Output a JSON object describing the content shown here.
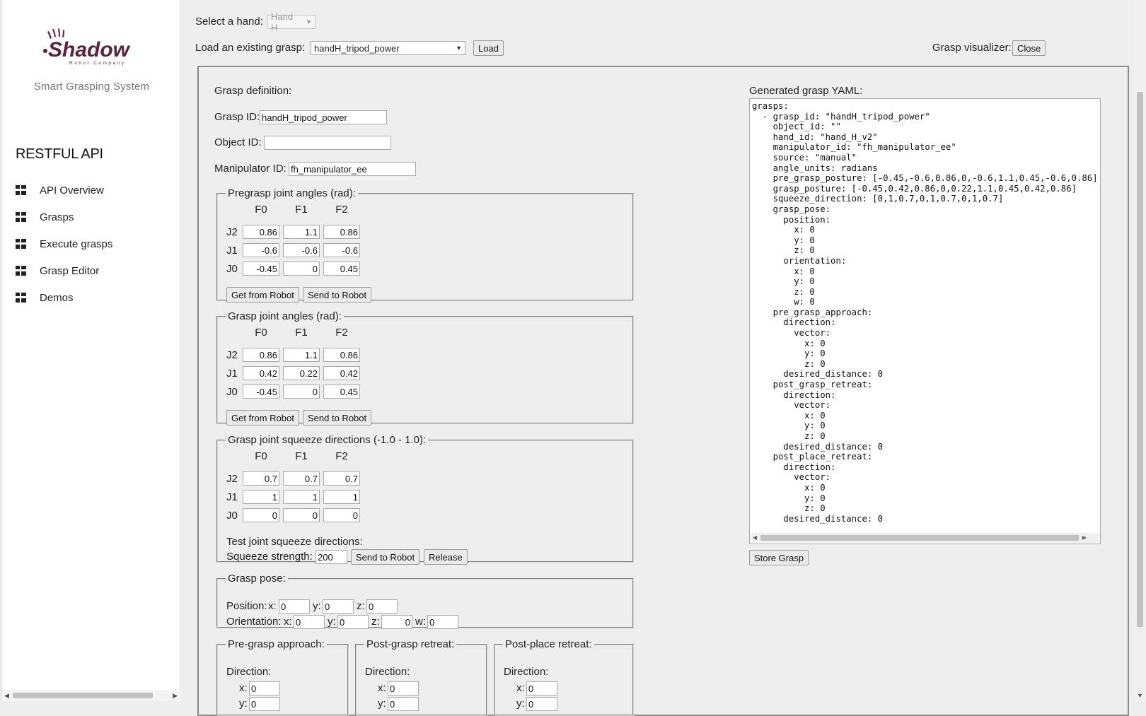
{
  "sidebar": {
    "logo_text": "Shadow",
    "logo_tagline": "Robot Company",
    "subtitle": "Smart Grasping System",
    "heading": "RESTFUL API",
    "nav": [
      {
        "label": "API Overview",
        "icon": "grid-icon"
      },
      {
        "label": "Grasps",
        "icon": "grid-icon"
      },
      {
        "label": "Execute grasps",
        "icon": "grid-icon"
      },
      {
        "label": "Grasp Editor",
        "icon": "grid-icon"
      },
      {
        "label": "Demos",
        "icon": "grid-icon"
      }
    ]
  },
  "top": {
    "select_hand_label": "Select a hand:",
    "hand_value": "Hand H",
    "load_label": "Load an existing grasp:",
    "grasp_value": "handH_tripod_power",
    "load_button": "Load",
    "visualizer_label": "Grasp visualizer:",
    "close_button": "Close"
  },
  "definition": {
    "title": "Grasp definition:",
    "grasp_id_label": "Grasp ID:",
    "grasp_id": "handH_tripod_power",
    "object_id_label": "Object ID:",
    "object_id": "",
    "manipulator_id_label": "Manipulator ID:",
    "manipulator_id": "fh_manipulator_ee"
  },
  "columns": [
    "F0",
    "F1",
    "F2"
  ],
  "rows": [
    "J2",
    "J1",
    "J0"
  ],
  "pregrasp": {
    "title": "Pregrasp joint angles (rad):",
    "values": [
      [
        "0.86",
        "1.1",
        "0.86"
      ],
      [
        "-0.6",
        "-0.6",
        "-0.6"
      ],
      [
        "-0.45",
        "0",
        "0.45"
      ]
    ],
    "get_button": "Get from Robot",
    "send_button": "Send to Robot"
  },
  "grasp": {
    "title": "Grasp joint angles (rad):",
    "values": [
      [
        "0.86",
        "1.1",
        "0.86"
      ],
      [
        "0.42",
        "0.22",
        "0.42"
      ],
      [
        "-0.45",
        "0",
        "0.45"
      ]
    ],
    "get_button": "Get from Robot",
    "send_button": "Send to Robot"
  },
  "squeeze": {
    "title": "Grasp joint squeeze directions (-1.0 - 1.0):",
    "values": [
      [
        "0.7",
        "0.7",
        "0.7"
      ],
      [
        "1",
        "1",
        "1"
      ],
      [
        "0",
        "0",
        "0"
      ]
    ],
    "test_label": "Test joint squeeze directions:",
    "strength_label": "Squeeze strength:",
    "strength": "200",
    "send_button": "Send to Robot",
    "release_button": "Release"
  },
  "pose": {
    "title": "Grasp pose:",
    "position_label": "Position:",
    "orientation_label": "Orientation:",
    "x_label": "x:",
    "y_label": "y:",
    "z_label": "z:",
    "w_label": "w:",
    "position": {
      "x": "0",
      "y": "0",
      "z": "0"
    },
    "orientation": {
      "x": "0",
      "y": "0",
      "z": "0",
      "w": "0"
    }
  },
  "approach": {
    "pre": {
      "title": "Pre-grasp approach:",
      "direction_label": "Direction:",
      "x": "0",
      "y": "0"
    },
    "post_grasp": {
      "title": "Post-grasp retreat:",
      "direction_label": "Direction:",
      "x": "0",
      "y": "0"
    },
    "post_place": {
      "title": "Post-place retreat:",
      "direction_label": "Direction:",
      "x": "0",
      "y": "0"
    }
  },
  "yaml": {
    "title": "Generated grasp YAML:",
    "text": "grasps:\n  - grasp_id: \"handH_tripod_power\"\n    object_id: \"\"\n    hand_id: \"hand_H_v2\"\n    manipulator_id: \"fh_manipulator_ee\"\n    source: \"manual\"\n    angle_units: radians\n    pre_grasp_posture: [-0.45,-0.6,0.86,0,-0.6,1.1,0.45,-0.6,0.86]\n    grasp_posture: [-0.45,0.42,0.86,0,0.22,1.1,0.45,0.42,0.86]\n    squeeze_direction: [0,1,0.7,0,1,0.7,0,1,0.7]\n    grasp_pose:\n      position:\n        x: 0\n        y: 0\n        z: 0\n      orientation:\n        x: 0\n        y: 0\n        z: 0\n        w: 0\n    pre_grasp_approach:\n      direction:\n        vector:\n          x: 0\n          y: 0\n          z: 0\n      desired_distance: 0\n    post_grasp_retreat:\n      direction:\n        vector:\n          x: 0\n          y: 0\n          z: 0\n      desired_distance: 0\n    post_place_retreat:\n      direction:\n        vector:\n          x: 0\n          y: 0\n          z: 0\n      desired_distance: 0",
    "store_button": "Store Grasp"
  }
}
